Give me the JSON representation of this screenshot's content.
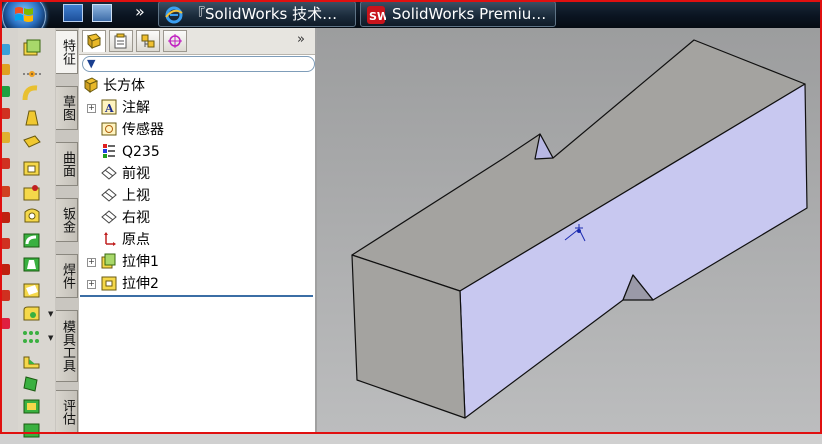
{
  "taskbar": {
    "tasks": [
      {
        "label": "『SolidWorks 技术…",
        "icon": "ie-icon"
      },
      {
        "label": "SolidWorks Premiu…",
        "icon": "solidworks-icon"
      }
    ],
    "overflow_glyph": "»"
  },
  "vertical_tabs": [
    "特征",
    "草图",
    "曲面",
    "钣金",
    "焊件",
    "模具工具",
    "评估"
  ],
  "feature_manager": {
    "expand_glyph": "»",
    "filter_icon": "funnel-icon",
    "tree": [
      {
        "label": "长方体",
        "icon": "part-icon"
      },
      {
        "label": "注解",
        "icon": "annotations-icon"
      },
      {
        "label": "传感器",
        "icon": "sensor-icon"
      },
      {
        "label": "Q235",
        "icon": "material-icon"
      },
      {
        "label": "前视",
        "icon": "plane-icon"
      },
      {
        "label": "上视",
        "icon": "plane-icon"
      },
      {
        "label": "右视",
        "icon": "plane-icon"
      },
      {
        "label": "原点",
        "icon": "origin-icon"
      },
      {
        "label": "拉伸1",
        "icon": "extrude-icon"
      },
      {
        "label": "拉伸2",
        "icon": "extrude-icon"
      }
    ]
  },
  "colors": {
    "frame": "#e01010",
    "taskbar": "#0b1522",
    "model_front": "#c8c8f0",
    "model_top": "#a4a3a0",
    "model_side": "#a4a3a0",
    "viewport_bg": "#a8a9aa"
  }
}
